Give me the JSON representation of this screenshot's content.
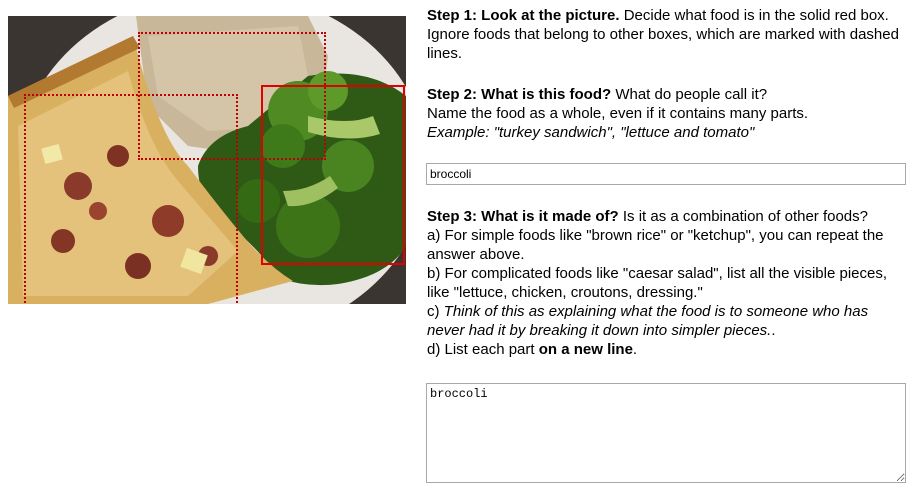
{
  "step1": {
    "heading": "Step 1: Look at the picture.",
    "text": " Decide what food is in the solid red box. Ignore foods that belong to other boxes, which are marked with dashed lines."
  },
  "step2": {
    "heading": "Step 2: What is this food?",
    "text": " What do people call it?",
    "line2": "Name the food as a whole, even if it contains many parts.",
    "example": "Example: \"turkey sandwich\", \"lettuce and tomato\""
  },
  "name_field": {
    "value": "broccoli"
  },
  "step3": {
    "heading": "Step 3: What is it made of?",
    "text": " Is it as a combination of other foods?",
    "a": "a) For simple foods like \"brown rice\" or \"ketchup\", you can repeat the answer above.",
    "b": "b) For complicated foods like \"caesar salad\", list all the visible pieces, like \"lettuce, chicken, croutons, dressing.\"",
    "c_prefix": "c) ",
    "c_italic": "Think of this as explaining what the food is to someone who has never had it by breaking it down into simpler pieces.",
    "c_suffix": ".",
    "d_prefix": "d) List each part ",
    "d_bold": "on a new line",
    "d_suffix": "."
  },
  "parts_field": {
    "value": "broccoli"
  },
  "colors": {
    "solid_box": "#e00000",
    "dashed_box": "#c00000"
  }
}
